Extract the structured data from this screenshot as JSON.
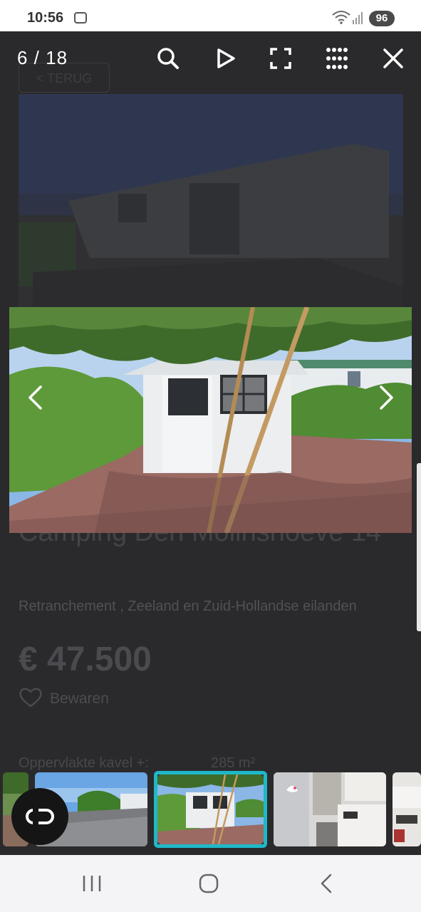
{
  "status_bar": {
    "time": "10:56",
    "battery": "96"
  },
  "background_page": {
    "back_button": "< TERUG",
    "title": "Camping Den Molinshoeve 14",
    "location": "Retranchement , Zeeland en Zuid-Hollandse eilanden",
    "price": "€ 47.500",
    "save_label": "Bewaren",
    "spec_label": "Oppervlakte kavel +:",
    "spec_value": "285 m²"
  },
  "viewer": {
    "counter": "6 / 18",
    "icons": [
      "search-icon",
      "play-icon",
      "fullscreen-icon",
      "grid-icon",
      "close-icon"
    ],
    "thumbnail_count": 6,
    "active_thumbnail": 3
  },
  "colors": {
    "accent": "#1fb8c8",
    "overlay": "#2b2b2d"
  }
}
